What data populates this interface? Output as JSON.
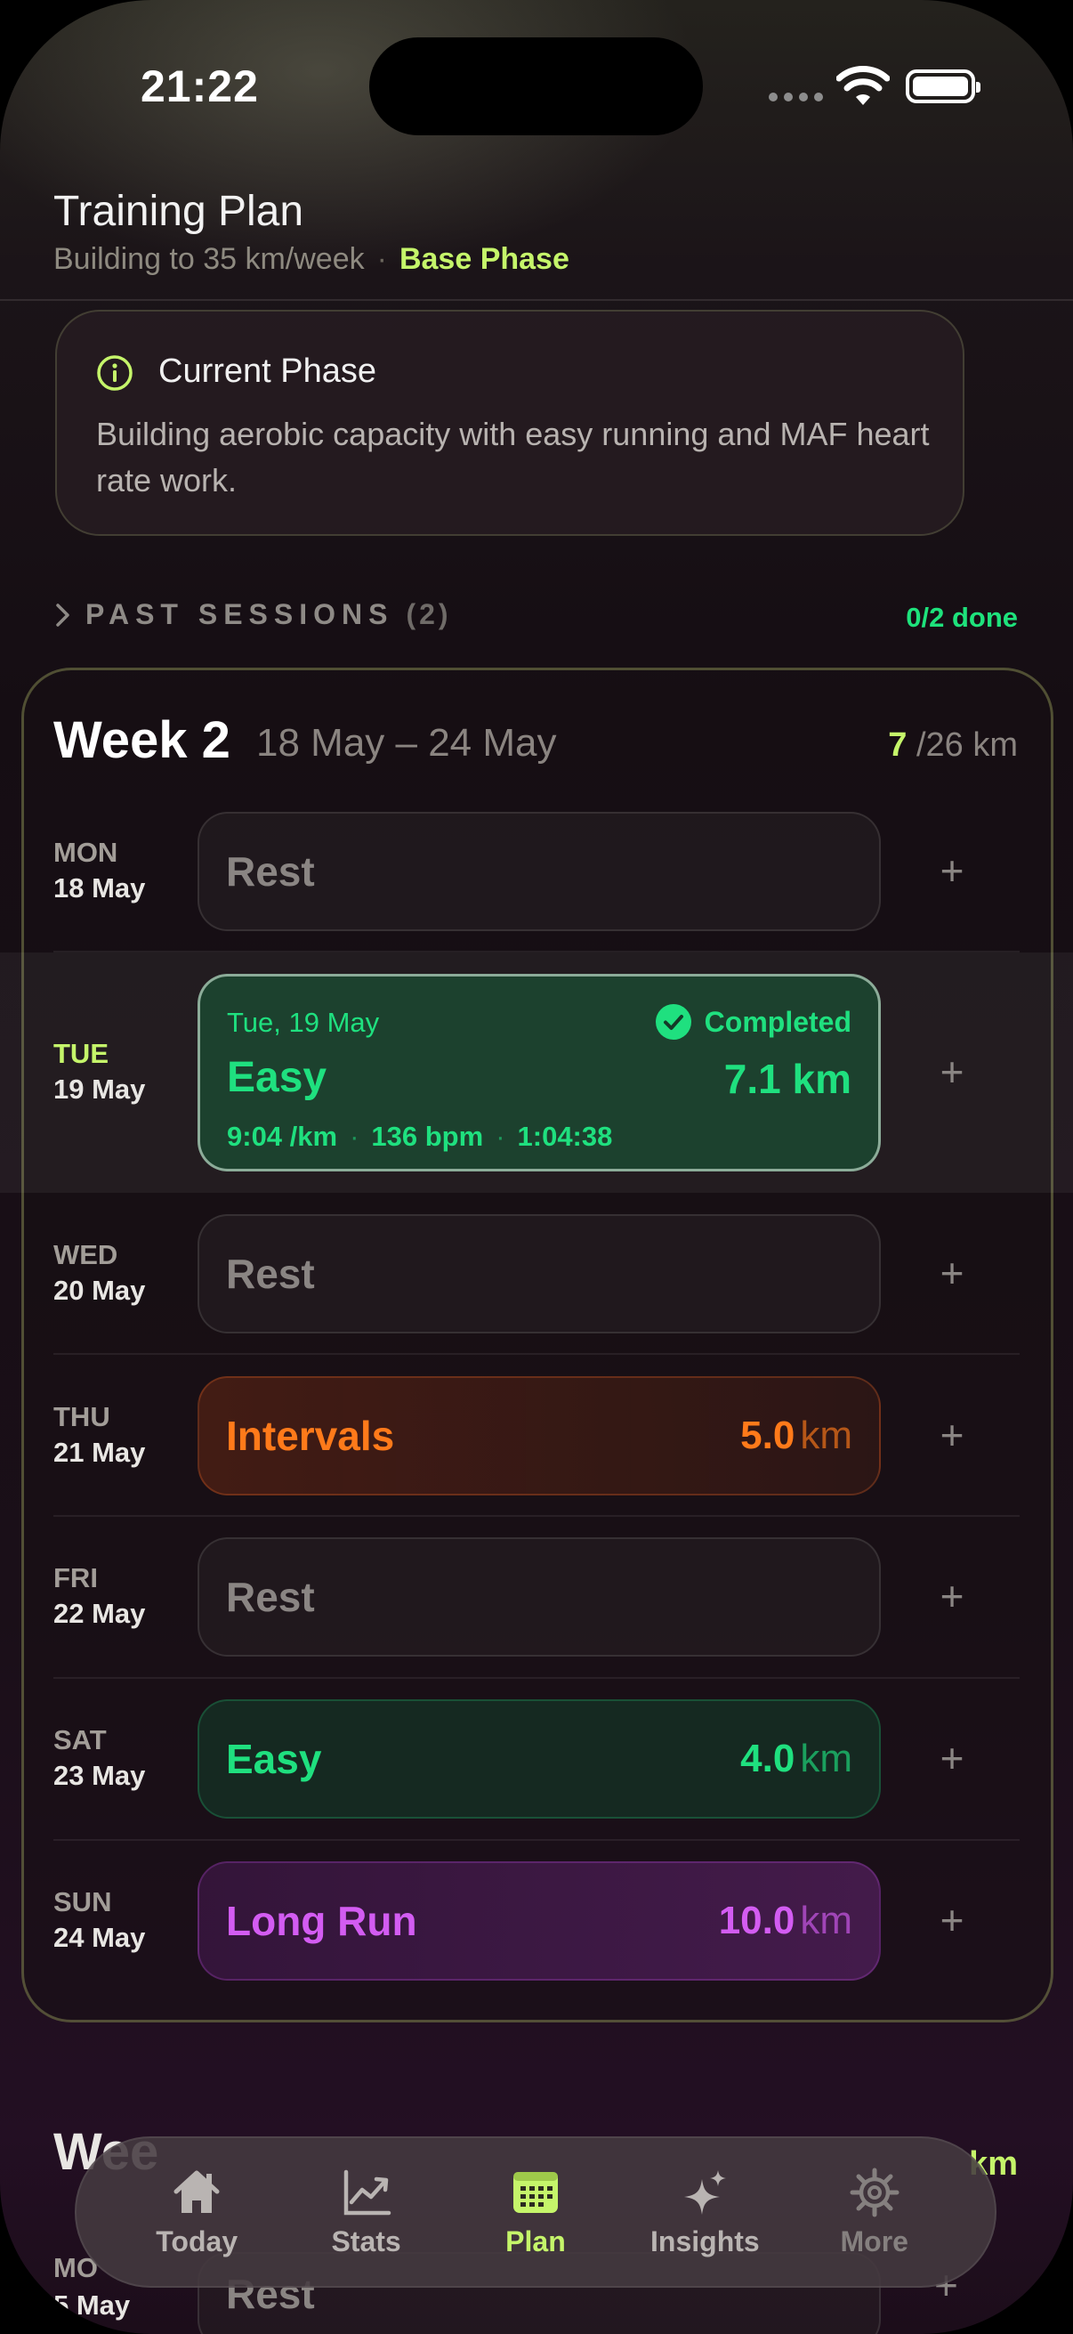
{
  "status_bar": {
    "time": "21:22"
  },
  "header": {
    "title": "Training Plan",
    "subtitle": "Building to 35 km/week",
    "separator": "·",
    "phase": "Base Phase"
  },
  "phase_card": {
    "icon": "info-icon",
    "title": "Current Phase",
    "body": "Building aerobic capacity with easy running and MAF heart rate work."
  },
  "past_sessions": {
    "label": "PAST SESSIONS",
    "count": "(2)",
    "done": "0/2 done"
  },
  "week": {
    "title": "Week 2",
    "range": "18 May – 24 May",
    "km_done": "7",
    "km_total": "/26 km",
    "days": [
      {
        "dow": "MON",
        "date": "18 May",
        "type": "rest",
        "name": "Rest",
        "km": "",
        "unit": ""
      },
      {
        "dow": "TUE",
        "date": "19 May",
        "type": "completed",
        "name": "Easy",
        "km": "7.1 km",
        "full_date": "Tue, 19 May",
        "status": "Completed",
        "stats": [
          "9:04 /km",
          "136 bpm",
          "1:04:38"
        ],
        "stat_sep": "·"
      },
      {
        "dow": "WED",
        "date": "20 May",
        "type": "rest",
        "name": "Rest",
        "km": "",
        "unit": ""
      },
      {
        "dow": "THU",
        "date": "21 May",
        "type": "intervals",
        "name": "Intervals",
        "km": "5.0",
        "unit": "km"
      },
      {
        "dow": "FRI",
        "date": "22 May",
        "type": "rest",
        "name": "Rest",
        "km": "",
        "unit": ""
      },
      {
        "dow": "SAT",
        "date": "23 May",
        "type": "easy",
        "name": "Easy",
        "km": "4.0",
        "unit": "km"
      },
      {
        "dow": "SUN",
        "date": "24 May",
        "type": "long",
        "name": "Long Run",
        "km": "10.0",
        "unit": "km"
      }
    ],
    "add_label": "+"
  },
  "next_week": {
    "title": "Wee",
    "km": "km",
    "dow": "MO",
    "date": "5 May",
    "first_session": "Rest",
    "add_label": "+"
  },
  "tabbar": {
    "tabs": [
      {
        "label": "Today",
        "icon": "home-icon"
      },
      {
        "label": "Stats",
        "icon": "chart-icon"
      },
      {
        "label": "Plan",
        "icon": "calendar-icon",
        "active": true
      },
      {
        "label": "Insights",
        "icon": "sparkles-icon"
      },
      {
        "label": "More",
        "icon": "gear-icon"
      }
    ]
  },
  "colors": {
    "accent_lime": "#c5f56a",
    "easy_green": "#1fe07f",
    "intervals_orange": "#ff7a1a",
    "long_purple": "#d35cf2"
  }
}
